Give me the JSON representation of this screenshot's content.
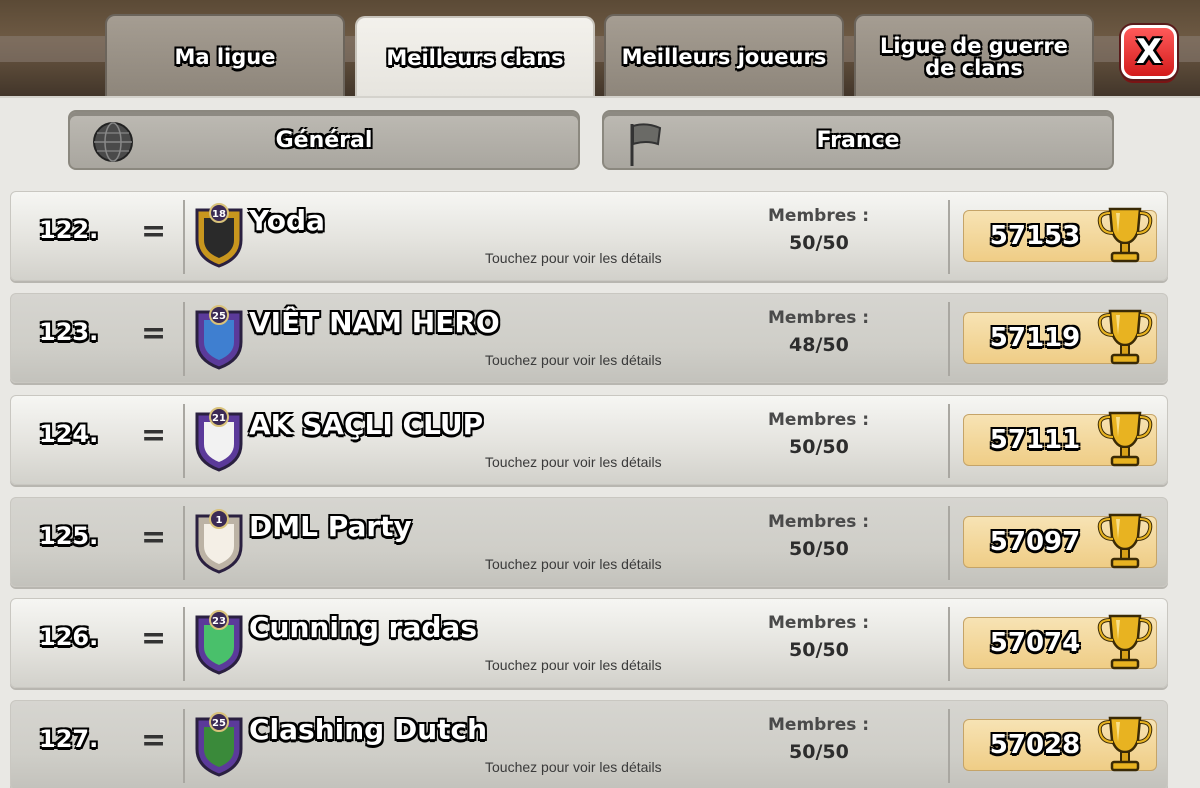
{
  "tabs": [
    {
      "label": "Ma ligue"
    },
    {
      "label": "Meilleurs clans"
    },
    {
      "label": "Meilleurs joueurs"
    },
    {
      "label": "Ligue de guerre de clans"
    }
  ],
  "close_label": "X",
  "filters": {
    "global": "Général",
    "local": "France"
  },
  "members_label": "Membres :",
  "hint_text": "Touchez pour voir les détails",
  "clans": [
    {
      "rank": "122.",
      "trend": "=",
      "name": "Yoda",
      "badge_level": "18",
      "members": "50/50",
      "trophies": "57153"
    },
    {
      "rank": "123.",
      "trend": "=",
      "name": "VIÊT NAM HERO",
      "badge_level": "25",
      "members": "48/50",
      "trophies": "57119"
    },
    {
      "rank": "124.",
      "trend": "=",
      "name": "AK SAÇLI CLUP",
      "badge_level": "21",
      "members": "50/50",
      "trophies": "57111"
    },
    {
      "rank": "125.",
      "trend": "=",
      "name": "DML Party",
      "badge_level": "1",
      "members": "50/50",
      "trophies": "57097"
    },
    {
      "rank": "126.",
      "trend": "=",
      "name": "Cunning radas",
      "badge_level": "23",
      "members": "50/50",
      "trophies": "57074"
    },
    {
      "rank": "127.",
      "trend": "=",
      "name": "Clashing Dutch",
      "badge_level": "25",
      "members": "50/50",
      "trophies": "57028"
    }
  ],
  "colors": {
    "close_button": "#e52a2a",
    "trophy_box": "#f2d592",
    "trophy_gold": "#e8b321"
  }
}
